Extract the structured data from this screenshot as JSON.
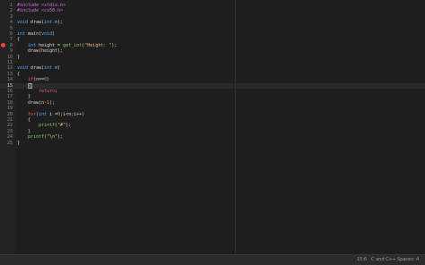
{
  "editor": {
    "active_line": 15,
    "breakpoint_line": 8,
    "lines": [
      {
        "n": "1",
        "tokens": [
          {
            "t": "#include <stdio.h>",
            "c": "pre"
          }
        ]
      },
      {
        "n": "2",
        "tokens": [
          {
            "t": "#include <cs50.h>",
            "c": "pre"
          }
        ]
      },
      {
        "n": "3",
        "tokens": []
      },
      {
        "n": "4",
        "tokens": [
          {
            "t": "void",
            "c": "ty"
          },
          {
            "t": " draw(",
            "c": ""
          },
          {
            "t": "int",
            "c": "ty"
          },
          {
            "t": " n);",
            "c": ""
          }
        ]
      },
      {
        "n": "5",
        "tokens": []
      },
      {
        "n": "6",
        "tokens": [
          {
            "t": "int",
            "c": "ty"
          },
          {
            "t": " main(",
            "c": ""
          },
          {
            "t": "void",
            "c": "ty"
          },
          {
            "t": ")",
            "c": ""
          }
        ]
      },
      {
        "n": "7",
        "tokens": [
          {
            "t": "{",
            "c": ""
          }
        ]
      },
      {
        "n": "8",
        "tokens": [
          {
            "t": "    ",
            "c": ""
          },
          {
            "t": "int",
            "c": "ty"
          },
          {
            "t": " height = ",
            "c": ""
          },
          {
            "t": "get_int",
            "c": "fn"
          },
          {
            "t": "(",
            "c": ""
          },
          {
            "t": "\"Height: \"",
            "c": "st"
          },
          {
            "t": ");",
            "c": ""
          }
        ]
      },
      {
        "n": "9",
        "tokens": [
          {
            "t": "    draw(height);",
            "c": ""
          }
        ]
      },
      {
        "n": "10",
        "tokens": [
          {
            "t": "}",
            "c": ""
          }
        ]
      },
      {
        "n": "11",
        "tokens": []
      },
      {
        "n": "12",
        "tokens": [
          {
            "t": "void",
            "c": "ty"
          },
          {
            "t": " draw(",
            "c": ""
          },
          {
            "t": "int",
            "c": "ty"
          },
          {
            "t": " n)",
            "c": ""
          }
        ]
      },
      {
        "n": "13",
        "tokens": [
          {
            "t": "{",
            "c": ""
          }
        ]
      },
      {
        "n": "14",
        "tokens": [
          {
            "t": "    ",
            "c": ""
          },
          {
            "t": "if",
            "c": "kw"
          },
          {
            "t": "(n==",
            "c": ""
          },
          {
            "t": "0",
            "c": "nm"
          },
          {
            "t": ")",
            "c": ""
          }
        ]
      },
      {
        "n": "15",
        "tokens": [
          {
            "t": "    ",
            "c": ""
          },
          {
            "t": "{",
            "c": "cursor"
          }
        ]
      },
      {
        "n": "16",
        "tokens": [
          {
            "t": "        ",
            "c": ""
          },
          {
            "t": "return",
            "c": "kw"
          },
          {
            "t": ";",
            "c": ""
          }
        ]
      },
      {
        "n": "17",
        "tokens": [
          {
            "t": "    }",
            "c": ""
          }
        ]
      },
      {
        "n": "18",
        "tokens": [
          {
            "t": "    draw(n-",
            "c": ""
          },
          {
            "t": "1",
            "c": "nm"
          },
          {
            "t": ");",
            "c": ""
          }
        ]
      },
      {
        "n": "19",
        "tokens": []
      },
      {
        "n": "20",
        "tokens": [
          {
            "t": "    ",
            "c": ""
          },
          {
            "t": "for",
            "c": "kw"
          },
          {
            "t": "(",
            "c": ""
          },
          {
            "t": "int",
            "c": "ty"
          },
          {
            "t": " i =",
            "c": ""
          },
          {
            "t": "0",
            "c": "nm"
          },
          {
            "t": ";i<n;i++)",
            "c": ""
          }
        ]
      },
      {
        "n": "21",
        "tokens": [
          {
            "t": "    {",
            "c": ""
          }
        ]
      },
      {
        "n": "22",
        "tokens": [
          {
            "t": "        ",
            "c": ""
          },
          {
            "t": "printf",
            "c": "fn"
          },
          {
            "t": "(",
            "c": ""
          },
          {
            "t": "\"#\"",
            "c": "st"
          },
          {
            "t": ");",
            "c": ""
          }
        ]
      },
      {
        "n": "23",
        "tokens": [
          {
            "t": "    }",
            "c": ""
          }
        ]
      },
      {
        "n": "24",
        "tokens": [
          {
            "t": "    ",
            "c": ""
          },
          {
            "t": "printf",
            "c": "fn"
          },
          {
            "t": "(",
            "c": ""
          },
          {
            "t": "\"\\n\"",
            "c": "st"
          },
          {
            "t": ");",
            "c": ""
          }
        ]
      },
      {
        "n": "25",
        "tokens": [
          {
            "t": "}",
            "c": ""
          }
        ]
      }
    ]
  },
  "statusbar": {
    "position": "15:6",
    "language": "C and C++",
    "indent": "Spaces: 4"
  }
}
